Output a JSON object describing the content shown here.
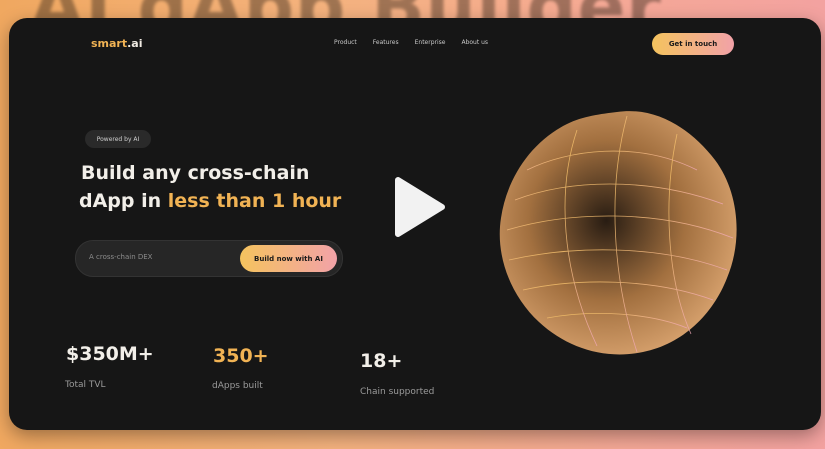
{
  "background_title": "AI dApp Builder",
  "nav": {
    "logo_main": "smart",
    "logo_suffix": ".ai",
    "links": [
      "Product",
      "Features",
      "Enterprise",
      "About us"
    ],
    "cta": "Get in touch"
  },
  "hero": {
    "badge": "Powered by AI",
    "headline_line1": "Build any cross-chain",
    "headline_line2_prefix": "dApp in ",
    "headline_line2_highlight": "less than 1 hour",
    "search_placeholder": "A cross-chain DEX",
    "build_button": "Build now with AI"
  },
  "stats": [
    {
      "value": "$350M+",
      "label": "Total TVL"
    },
    {
      "value": "350+",
      "label": "dApps built"
    },
    {
      "value": "18+",
      "label": "Chain supported"
    }
  ],
  "colors": {
    "accent": "#f1b354",
    "gradient_start": "#f4c35e",
    "gradient_end": "#f2a2a8",
    "panel": "#161616"
  },
  "overlay_icon": "play-icon"
}
